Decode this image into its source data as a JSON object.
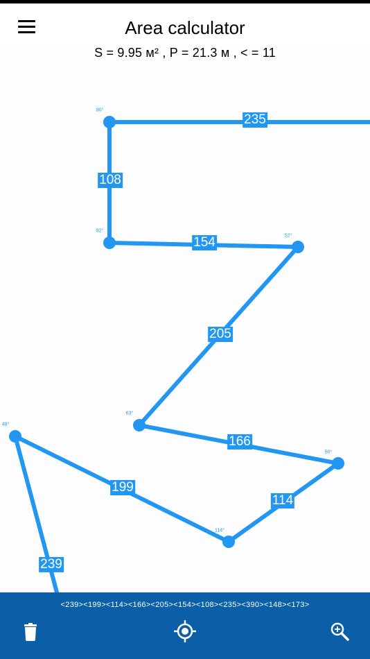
{
  "app": {
    "title": "Area calculator",
    "stats": "S = 9.95 м² , P = 21.3 м , < = 11"
  },
  "polyline": {
    "color": "#2196f3",
    "edges": [
      {
        "label": "235"
      },
      {
        "label": "108"
      },
      {
        "label": "154"
      },
      {
        "label": "205"
      },
      {
        "label": "166"
      },
      {
        "label": "114"
      },
      {
        "label": "199"
      },
      {
        "label": "239"
      }
    ],
    "angles": [
      "90°",
      "92°",
      "52°",
      "63°",
      "50°",
      "114°",
      "48°"
    ]
  },
  "bottom_bar": {
    "sequence": "<239><199><114><166><205><154><108><235><390><148><173>",
    "background": "#0a5fa8",
    "buttons": [
      {
        "icon": "trash-icon"
      },
      {
        "icon": "locate-icon"
      },
      {
        "icon": "zoom-in-icon"
      }
    ]
  }
}
